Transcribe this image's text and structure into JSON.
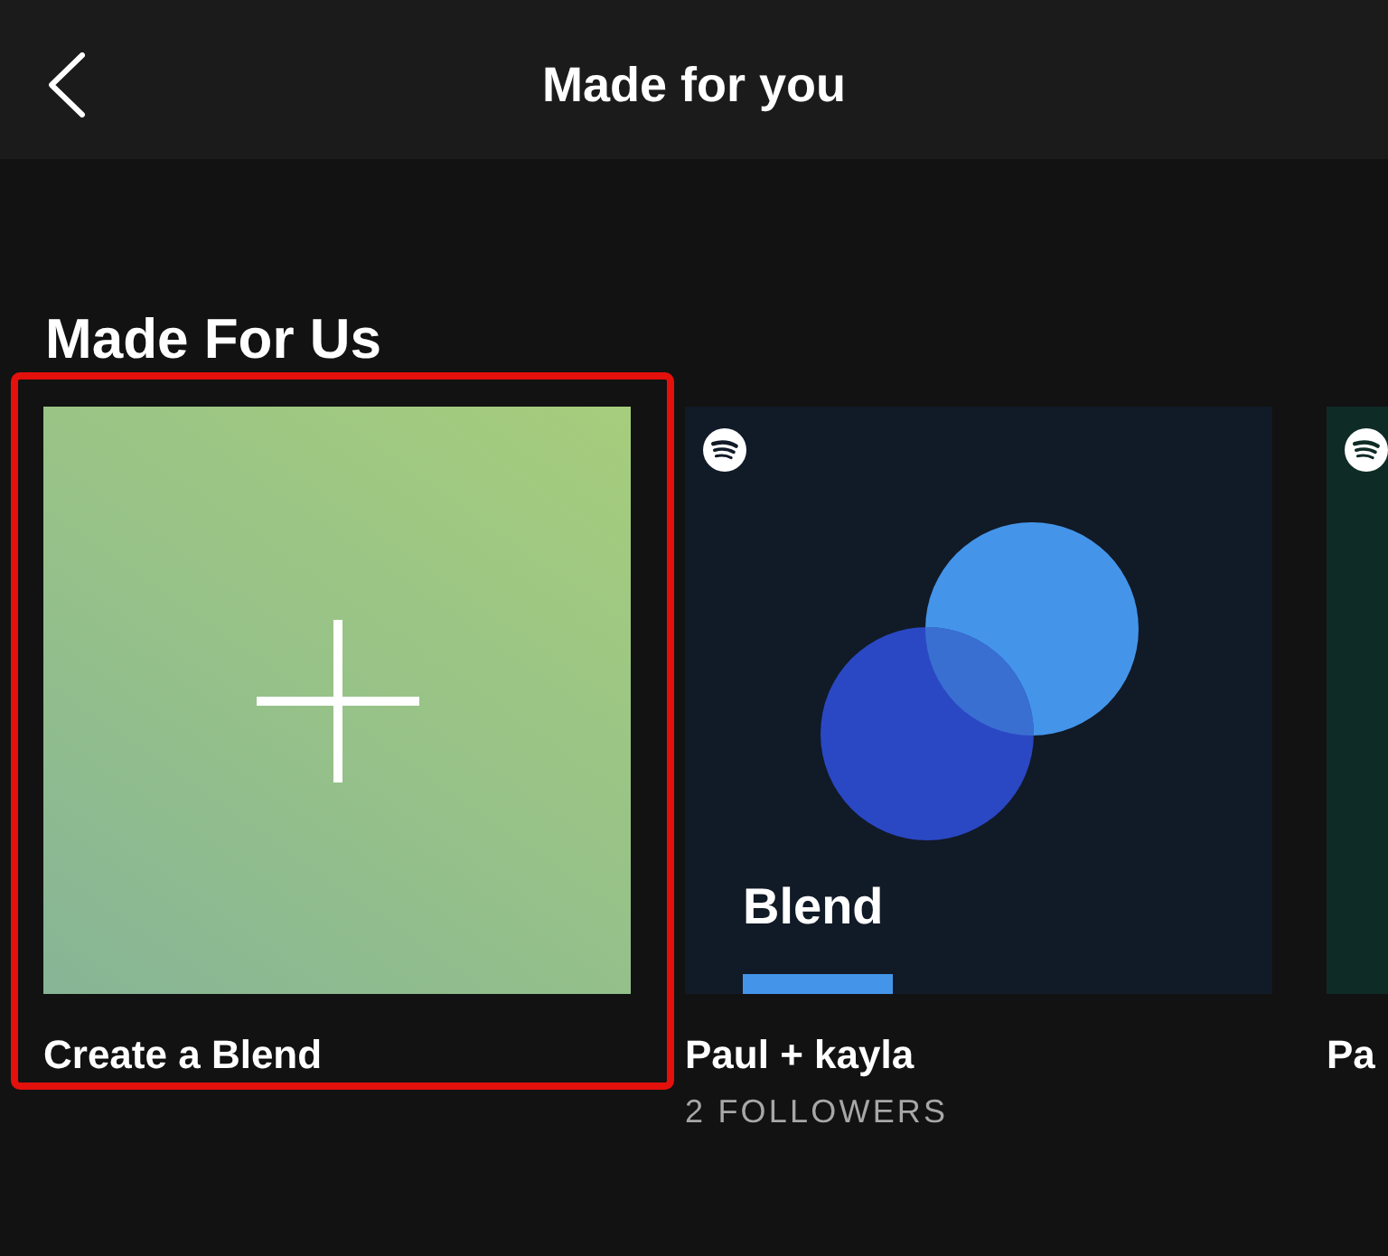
{
  "header": {
    "title": "Made for you"
  },
  "sections": [
    {
      "heading": "Made For Us",
      "cards": [
        {
          "kind": "create",
          "title": "Create a Blend",
          "highlighted": true
        },
        {
          "kind": "blend",
          "title": "Paul + kayla",
          "subtitle": "2 FOLLOWERS",
          "highlighted": false,
          "cover": {
            "color": "#111a27",
            "logo": true,
            "circles": true,
            "label": "Blend",
            "bar": true
          }
        },
        {
          "kind": "blend",
          "title": "Pa",
          "highlighted": false,
          "cover": {
            "color": "#0f2b26",
            "logo": true
          }
        }
      ]
    }
  ]
}
